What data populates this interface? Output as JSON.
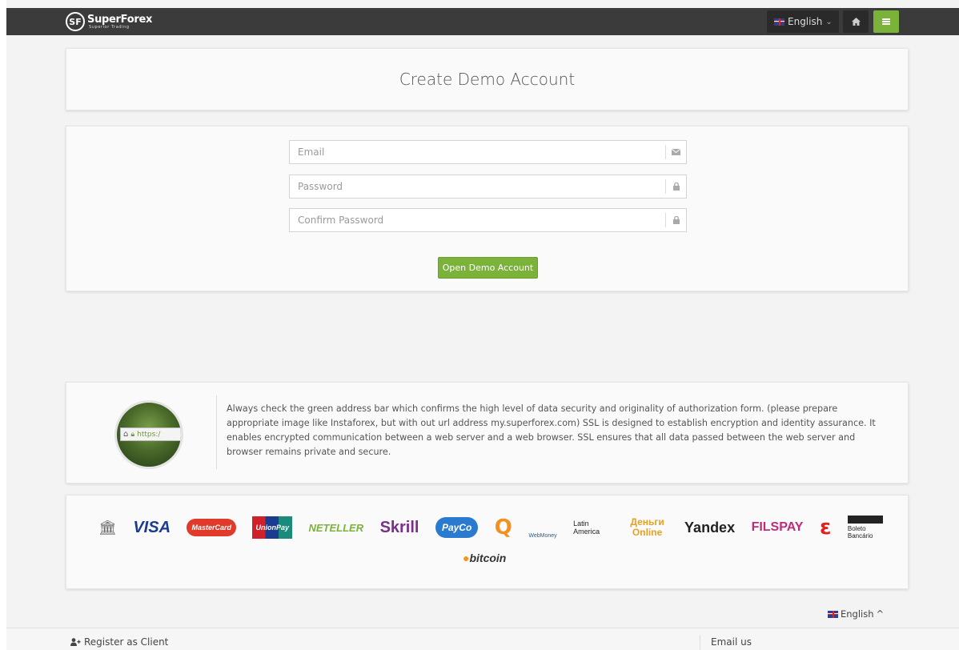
{
  "header": {
    "logo_mark": "SF",
    "logo_name": "SuperForex",
    "logo_tagline": "Superior Trading",
    "language_label": "English",
    "language_caret": "⌄"
  },
  "title_card": {
    "title": "Create Demo Account"
  },
  "form": {
    "email_placeholder": "Email",
    "password_placeholder": "Password",
    "confirm_placeholder": "Confirm Password",
    "submit_label": "Open Demo Account"
  },
  "ssl_card": {
    "badge_url_text": "https:/",
    "text": "Always check the green address bar which confirms the high level of data security and originality of authorization form. (please prepare appropriate image like Instaforex, but with out url address my.superforex.com) SSL is designed to establish encryption and identity assurance. It enables encrypted communication between a web server and a web browser. SSL ensures that all data passed between the web server and browser remains private and secure."
  },
  "payments": {
    "row1": [
      {
        "name": "visa",
        "label": "VISA",
        "color": "#1a3b8f"
      },
      {
        "name": "mastercard",
        "label": "MasterCard",
        "color": "#e23a2a"
      },
      {
        "name": "unionpay",
        "label": "UnionPay",
        "color": "#d0202a"
      },
      {
        "name": "neteller",
        "label": "NETELLER",
        "color": "#7ab23a"
      },
      {
        "name": "skrill",
        "label": "Skrill",
        "color": "#7a2f8a"
      },
      {
        "name": "payco",
        "label": "PayCo",
        "color": "#2a7ad0"
      },
      {
        "name": "webmoney",
        "label": "WebMoney",
        "color": "#2a5aa0"
      },
      {
        "name": "latin-america",
        "label": "Latin America",
        "color": "#222"
      },
      {
        "name": "dengi-online",
        "label": "Деньги Online",
        "color": "#e8a020"
      },
      {
        "name": "yandex",
        "label": "Yandex",
        "color": "#222"
      },
      {
        "name": "filspay",
        "label": "FILSPAY",
        "color": "#c02a7a"
      },
      {
        "name": "boleto",
        "label": "Boleto Bancário",
        "color": "#222"
      }
    ],
    "row2_bitcoin": "bitcoin"
  },
  "footer": {
    "language_label": "English",
    "language_caret": "^",
    "register_label": "Register as Client",
    "email_label": "Email us"
  }
}
